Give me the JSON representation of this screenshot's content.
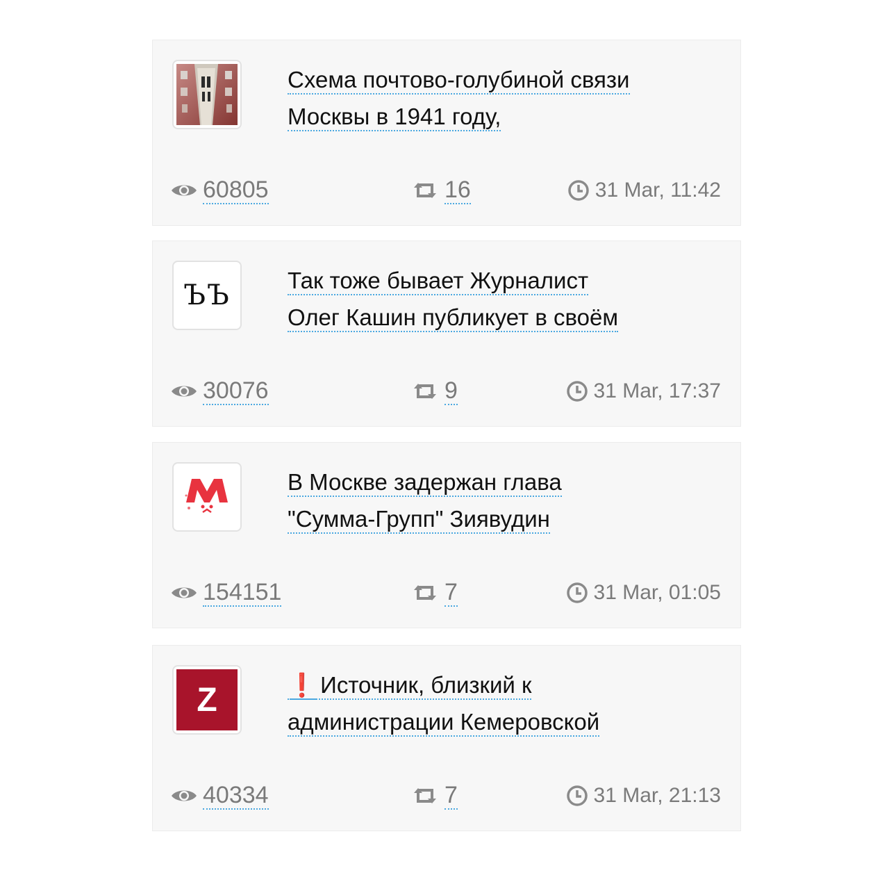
{
  "posts": [
    {
      "avatar_icon": "building-photo-icon",
      "title_lines": [
        "Схема почтово-голубиной связи",
        "Москвы в 1941 году,"
      ],
      "alert": "",
      "views": "60805",
      "reposts": "16",
      "time": "31 Mar, 11:42"
    },
    {
      "avatar_icon": "double-yat-logo-icon",
      "avatar_text": "ЪЪ",
      "title_lines": [
        "Так тоже бывает Журналист",
        "Олег Кашин публикует в своём"
      ],
      "alert": "",
      "views": "30076",
      "reposts": "9",
      "time": "31 Mar, 17:37"
    },
    {
      "avatar_icon": "red-m-logo-icon",
      "title_lines": [
        "В Москве задержан глава",
        "\"Сумма-Групп\" Зиявудин"
      ],
      "alert": "",
      "views": "154151",
      "reposts": "7",
      "time": "31 Mar, 01:05"
    },
    {
      "avatar_icon": "red-z-logo-icon",
      "avatar_text": "Z",
      "title_lines": [
        "Источник, близкий к",
        "администрации Кемеровской"
      ],
      "alert": "❗",
      "views": "40334",
      "reposts": "7",
      "time": "31 Mar, 21:13"
    }
  ],
  "colors": {
    "card_bg": "#f7f7f7",
    "link_underline": "#4aa8e0",
    "stat_text": "#7a7a7a",
    "z_logo_bg": "#a8142b",
    "m_logo": "#e8333f"
  }
}
